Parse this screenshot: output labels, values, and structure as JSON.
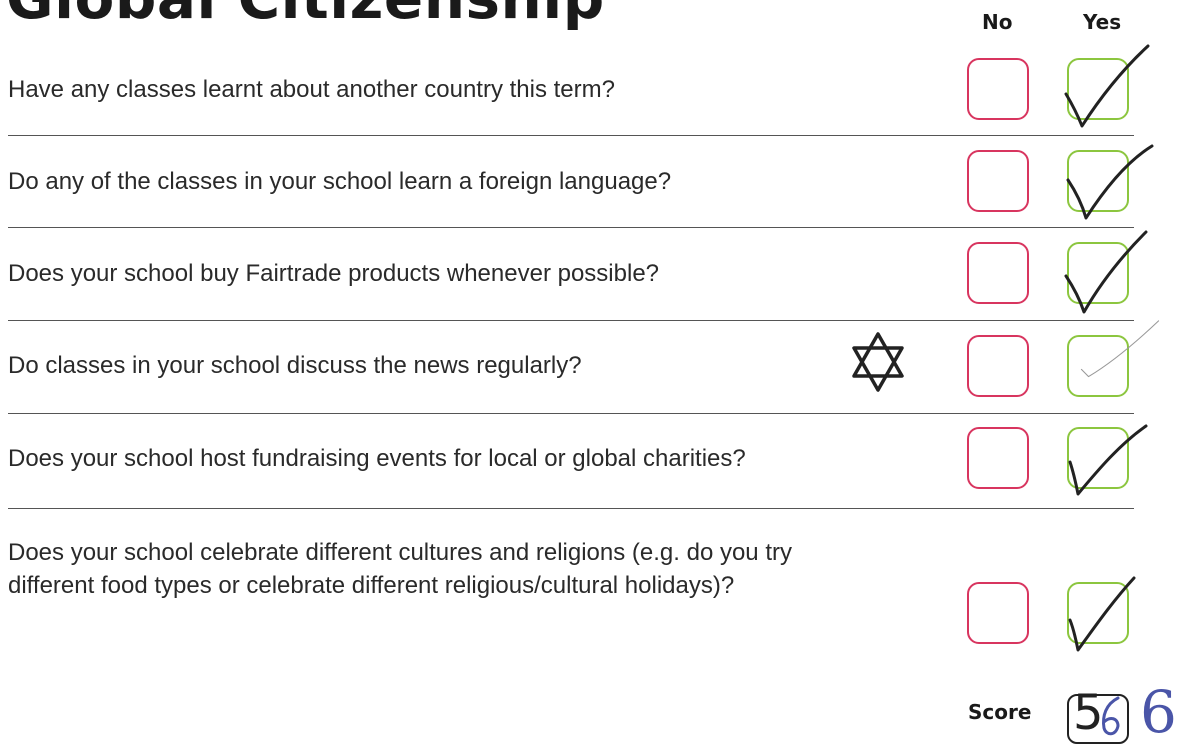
{
  "title": "Global Citizenship",
  "columns": {
    "no": "No",
    "yes": "Yes"
  },
  "questions": [
    {
      "text": "Have any classes learnt about another country this term?",
      "answer": "Yes"
    },
    {
      "text": "Do any of the classes in your school learn a foreign language?",
      "answer": "Yes"
    },
    {
      "text": "Does your school buy Fairtrade products whenever possible?",
      "answer": "Yes"
    },
    {
      "text": "Do classes in your school discuss the news regularly?",
      "answer": "Yes"
    },
    {
      "text": "Does your school host fundraising events for local or global charities?",
      "answer": "Yes"
    },
    {
      "text": "Does your school celebrate different cultures and religions (e.g. do you try different food types or celebrate different religious/cultural holidays)?",
      "answer": "Yes"
    }
  ],
  "score": {
    "label": "Score",
    "printed": "5",
    "handwritten": "6"
  },
  "colors": {
    "no_box": "#d8355f",
    "yes_box": "#8cc63f",
    "handwriting": "#4a55a8"
  },
  "icons": {
    "tick": "checkmark-icon",
    "star": "star-of-david-icon"
  }
}
